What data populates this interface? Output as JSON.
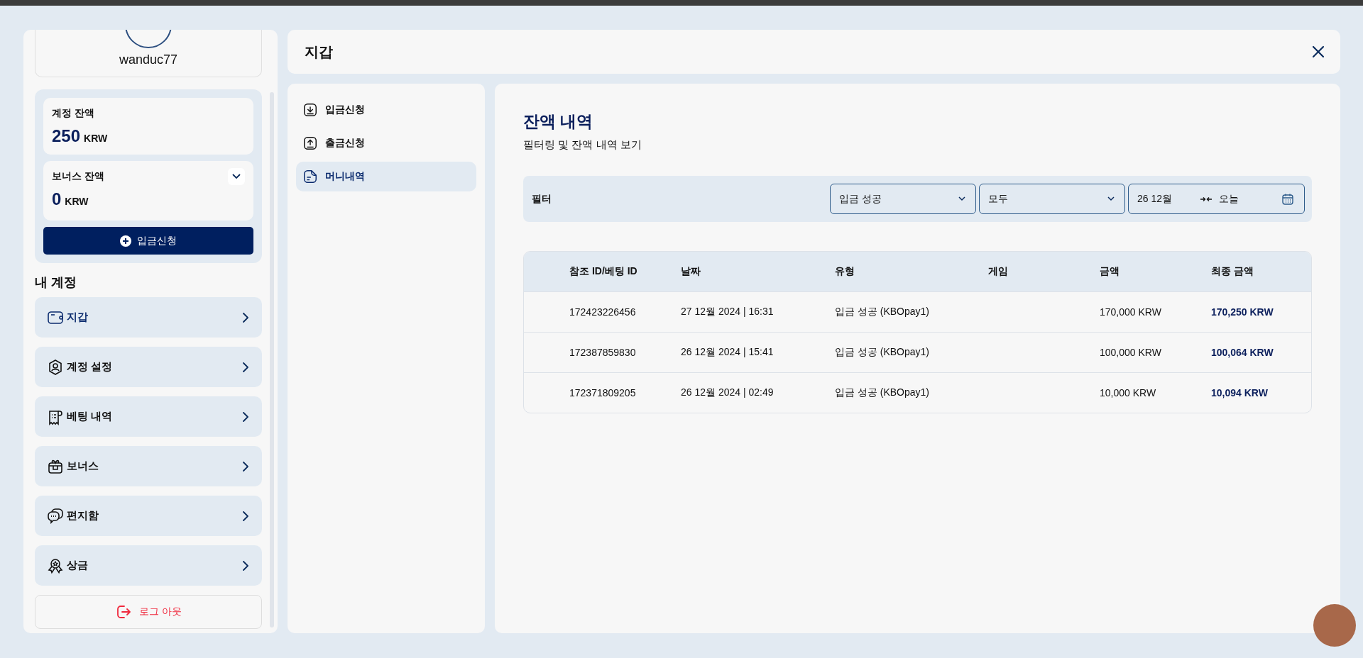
{
  "profile": {
    "username": "wanduc77"
  },
  "balances": [
    {
      "label": "계정 잔액",
      "amount": "250",
      "currency": "KRW",
      "kind": "plain"
    },
    {
      "label": "보너스 잔액",
      "amount": "0",
      "currency": "KRW",
      "kind": "dropdown"
    }
  ],
  "deposit_button": "입금신청",
  "account_menu": {
    "title": "내 계정",
    "items": [
      {
        "label": "지갑",
        "selected": true
      },
      {
        "label": "계정 설정",
        "selected": false
      },
      {
        "label": "베팅 내역",
        "selected": false
      },
      {
        "label": "보너스",
        "selected": false
      },
      {
        "label": "편지함",
        "selected": false
      },
      {
        "label": "상금",
        "selected": false
      }
    ]
  },
  "logout": "로그 아웃",
  "header": {
    "title": "지갑"
  },
  "wallet_menu": [
    {
      "label": "입금신청",
      "selected": false
    },
    {
      "label": "출금신청",
      "selected": false
    },
    {
      "label": "머니내역",
      "selected": true
    }
  ],
  "history": {
    "title": "잔액 내역",
    "subtitle": "필터링 및 잔액 내역 보기",
    "filter": {
      "label": "필터",
      "type_value": "입금 성공",
      "scope_value": "모두",
      "date_from": "26 12월",
      "date_to": "오늘"
    },
    "table": {
      "columns": [
        "참조 ID/베팅 ID",
        "날짜",
        "유형",
        "게임",
        "금액",
        "최종 금액"
      ],
      "rows": [
        {
          "ref": "172423226456",
          "date": "27 12월 2024 | 16:31",
          "type": "입금 성공 (KBOpay1)",
          "amount": "170,000 KRW",
          "final": "170,250 KRW"
        },
        {
          "ref": "172387859830",
          "date": "26 12월 2024 | 15:41",
          "type": "입금 성공 (KBOpay1)",
          "amount": "100,000 KRW",
          "final": "100,064 KRW"
        },
        {
          "ref": "172371809205",
          "date": "26 12월 2024 | 02:49",
          "type": "입금 성공 (KBOpay1)",
          "amount": "10,000 KRW",
          "final": "10,094 KRW"
        }
      ]
    }
  }
}
